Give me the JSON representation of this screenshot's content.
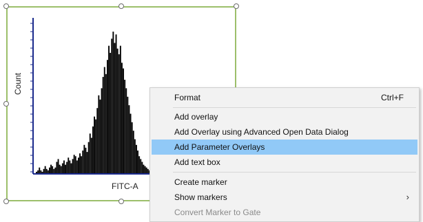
{
  "plot": {
    "y_axis_label": "Count",
    "x_axis_label": "FITC-A"
  },
  "chart_data": {
    "type": "area",
    "xlabel": "FITC-A",
    "ylabel": "Count",
    "series": [
      {
        "values": [
          0,
          1,
          2,
          4,
          2,
          1,
          3,
          5,
          3,
          2,
          4,
          6,
          5,
          3,
          4,
          8,
          10,
          6,
          5,
          7,
          9,
          6,
          8,
          11,
          9,
          7,
          10,
          13,
          12,
          9,
          11,
          14,
          12,
          16,
          20,
          18,
          15,
          22,
          28,
          25,
          33,
          40,
          38,
          46,
          55,
          52,
          60,
          68,
          75,
          70,
          80,
          90,
          85,
          95,
          100,
          92,
          98,
          88,
          84,
          90,
          78,
          74,
          66,
          60,
          54,
          48,
          42,
          36,
          30,
          24,
          20,
          16,
          12,
          10,
          8,
          6,
          5,
          4,
          3,
          2
        ]
      }
    ],
    "colors": {
      "bars": "#000000",
      "axes": "#1a2a8c"
    }
  },
  "context_menu": {
    "items": [
      {
        "label": "Format",
        "shortcut": "Ctrl+F"
      },
      {
        "label": "Add overlay"
      },
      {
        "label": "Add Overlay using Advanced Open Data Dialog"
      },
      {
        "label": "Add Parameter Overlays"
      },
      {
        "label": "Add text box"
      },
      {
        "label": "Create marker"
      },
      {
        "label": "Show markers",
        "submenu_arrow": "›"
      },
      {
        "label": "Convert Marker to Gate"
      }
    ],
    "highlight_color": "#91c9f7"
  }
}
